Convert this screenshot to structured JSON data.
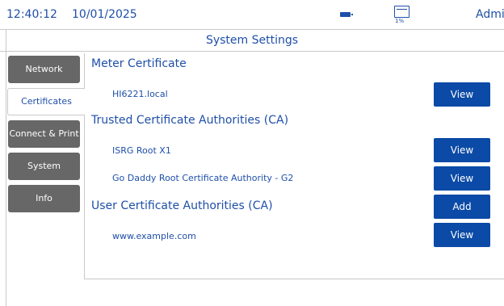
{
  "status_bar": {
    "time": "12:40:12",
    "date": "10/01/2025",
    "storage_percent": "1%",
    "user": "Admin",
    "battery_icon": "battery-icon",
    "storage_icon": "storage-folder-icon"
  },
  "title": "System Settings",
  "tabs": [
    {
      "label": "Network",
      "active": false
    },
    {
      "label": "Certificates",
      "active": true
    },
    {
      "label": "Connect & Print",
      "active": false
    },
    {
      "label": "System",
      "active": false
    },
    {
      "label": "Info",
      "active": false
    }
  ],
  "sections": {
    "meter": {
      "title": "Meter Certificate",
      "items": [
        {
          "label": "HI6221.local",
          "button": "View"
        }
      ]
    },
    "trusted": {
      "title": "Trusted Certificate Authorities (CA)",
      "items": [
        {
          "label": "ISRG Root X1",
          "button": "View"
        },
        {
          "label": "Go Daddy Root Certificate Authority - G2",
          "button": "View"
        }
      ]
    },
    "user": {
      "title": "User Certificate Authorities (CA)",
      "add_button": "Add",
      "items": [
        {
          "label": "www.example.com",
          "button": "View"
        }
      ]
    }
  },
  "colors": {
    "accent_text": "#1f4fa8",
    "button_bg": "#0b4aa6",
    "tab_inactive": "#676767"
  }
}
